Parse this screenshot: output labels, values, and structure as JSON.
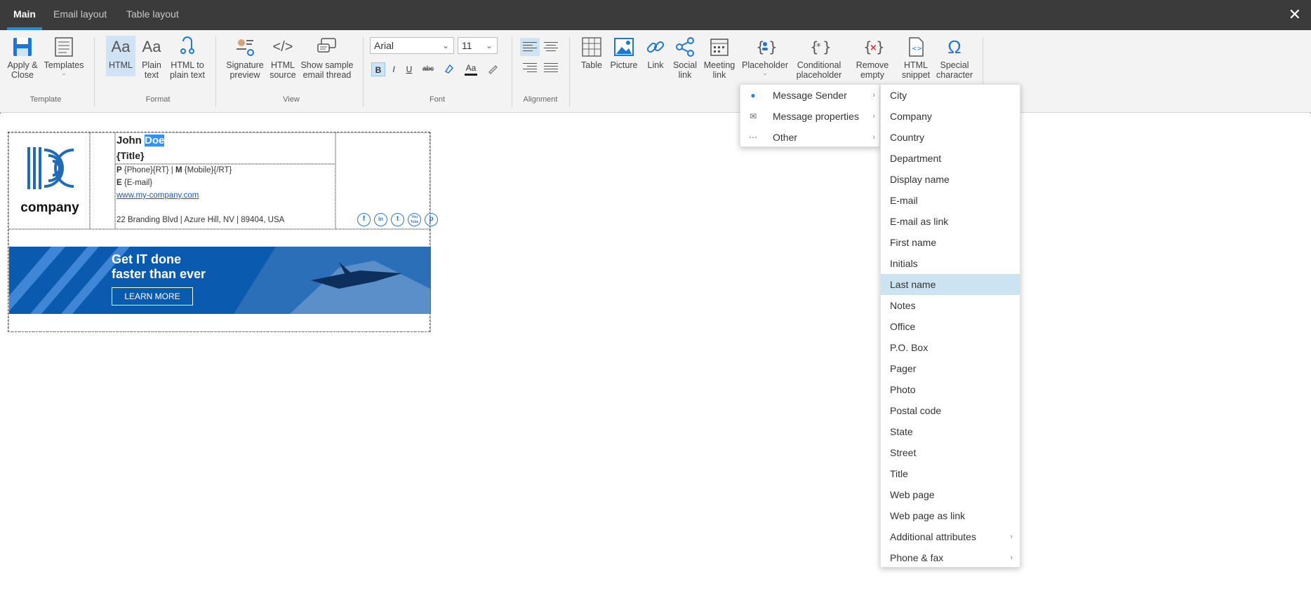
{
  "tabs": [
    "Main",
    "Email layout",
    "Table layout"
  ],
  "close_label": "✕",
  "ribbon": {
    "groups": {
      "template": "Template",
      "format": "Format",
      "view": "View",
      "font": "Font",
      "alignment": "Alignment"
    },
    "apply_close": [
      "Apply &",
      "Close"
    ],
    "templates": "Templates",
    "html": "HTML",
    "plain_text": [
      "Plain",
      "text"
    ],
    "html_to_plain": [
      "HTML to",
      "plain text"
    ],
    "signature_preview": [
      "Signature",
      "preview"
    ],
    "html_source": [
      "HTML",
      "source"
    ],
    "show_sample": [
      "Show sample",
      "email thread"
    ],
    "font_name": "Arial",
    "font_size": "11",
    "bold": "B",
    "italic": "I",
    "underline": "U",
    "strike": "abc",
    "font_color_label": "Aa",
    "table": "Table",
    "picture": "Picture",
    "link": "Link",
    "social_link": [
      "Social",
      "link"
    ],
    "meeting_link": [
      "Meeting",
      "link"
    ],
    "placeholder": "Placeholder",
    "conditional_placeholder": [
      "Conditional",
      "placeholder"
    ],
    "remove_empty": [
      "Remove",
      "empty"
    ],
    "html_snippet": [
      "HTML",
      "snippet"
    ],
    "special_character": [
      "Special",
      "character"
    ]
  },
  "signature": {
    "logo_text": "company",
    "first_name": "John",
    "last_name": "Doe",
    "title": "{Title}",
    "phone_prefix": "P",
    "phone_value": "{Phone}{RT} | ",
    "mobile_prefix": "M",
    "mobile_value": "{Mobile}{/RT}",
    "email_prefix": "E",
    "email_value": "{E-mail}",
    "website": "www.my-company.com",
    "address": "22 Branding Blvd | Azure Hill, NV | 89404, USA",
    "social": [
      "f",
      "in",
      "t",
      "You Tube",
      "p"
    ]
  },
  "banner": {
    "line1": "Get IT done",
    "line2": "faster than ever",
    "button": "LEARN MORE"
  },
  "menu_level1": [
    {
      "label": "Message Sender",
      "icon": "person-icon"
    },
    {
      "label": "Message properties",
      "icon": "envelope-icon"
    },
    {
      "label": "Other",
      "icon": "ellipsis-icon"
    }
  ],
  "menu_level2": [
    "City",
    "Company",
    "Country",
    "Department",
    "Display name",
    "E-mail",
    "E-mail as link",
    "First name",
    "Initials",
    "Last name",
    "Notes",
    "Office",
    "P.O. Box",
    "Pager",
    "Photo",
    "Postal code",
    "State",
    "Street",
    "Title",
    "Web page",
    "Web page as link",
    "Additional attributes",
    "Phone & fax"
  ],
  "menu_level2_highlight": "Last name",
  "colors": {
    "tabbar": "#3b3b3b",
    "accent": "#2b88d8",
    "highlight": "#cce4f1",
    "banner": "#0a5bb0"
  }
}
